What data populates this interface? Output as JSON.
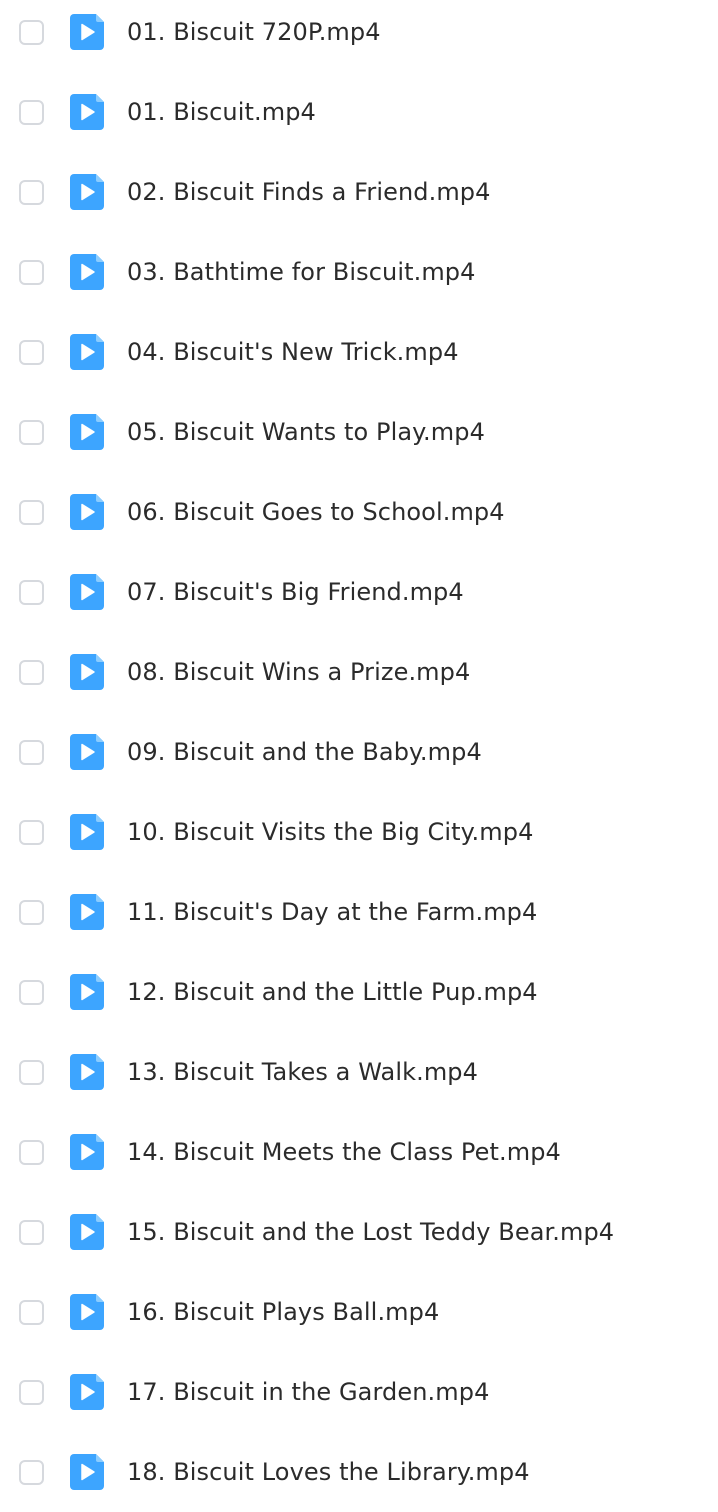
{
  "file_list": {
    "icon": "video-play-file-icon",
    "accent_color": "#3da5ff",
    "items": [
      {
        "name": "01. Biscuit 720P.mp4",
        "checked": false
      },
      {
        "name": "01. Biscuit.mp4",
        "checked": false
      },
      {
        "name": "02. Biscuit Finds a Friend.mp4",
        "checked": false
      },
      {
        "name": "03. Bathtime for Biscuit.mp4",
        "checked": false
      },
      {
        "name": "04. Biscuit's New Trick.mp4",
        "checked": false
      },
      {
        "name": "05. Biscuit Wants to Play.mp4",
        "checked": false
      },
      {
        "name": "06. Biscuit Goes to School.mp4",
        "checked": false
      },
      {
        "name": "07. Biscuit's Big Friend.mp4",
        "checked": false
      },
      {
        "name": "08. Biscuit Wins a Prize.mp4",
        "checked": false
      },
      {
        "name": "09. Biscuit and the Baby.mp4",
        "checked": false
      },
      {
        "name": "10. Biscuit Visits the Big City.mp4",
        "checked": false
      },
      {
        "name": "11. Biscuit's Day at the Farm.mp4",
        "checked": false
      },
      {
        "name": "12. Biscuit and the Little Pup.mp4",
        "checked": false
      },
      {
        "name": "13. Biscuit Takes a Walk.mp4",
        "checked": false
      },
      {
        "name": "14. Biscuit Meets the Class Pet.mp4",
        "checked": false
      },
      {
        "name": "15. Biscuit and the Lost Teddy Bear.mp4",
        "checked": false
      },
      {
        "name": "16. Biscuit Plays Ball.mp4",
        "checked": false
      },
      {
        "name": "17. Biscuit in the Garden.mp4",
        "checked": false
      },
      {
        "name": "18. Biscuit Loves the Library.mp4",
        "checked": false
      }
    ]
  }
}
